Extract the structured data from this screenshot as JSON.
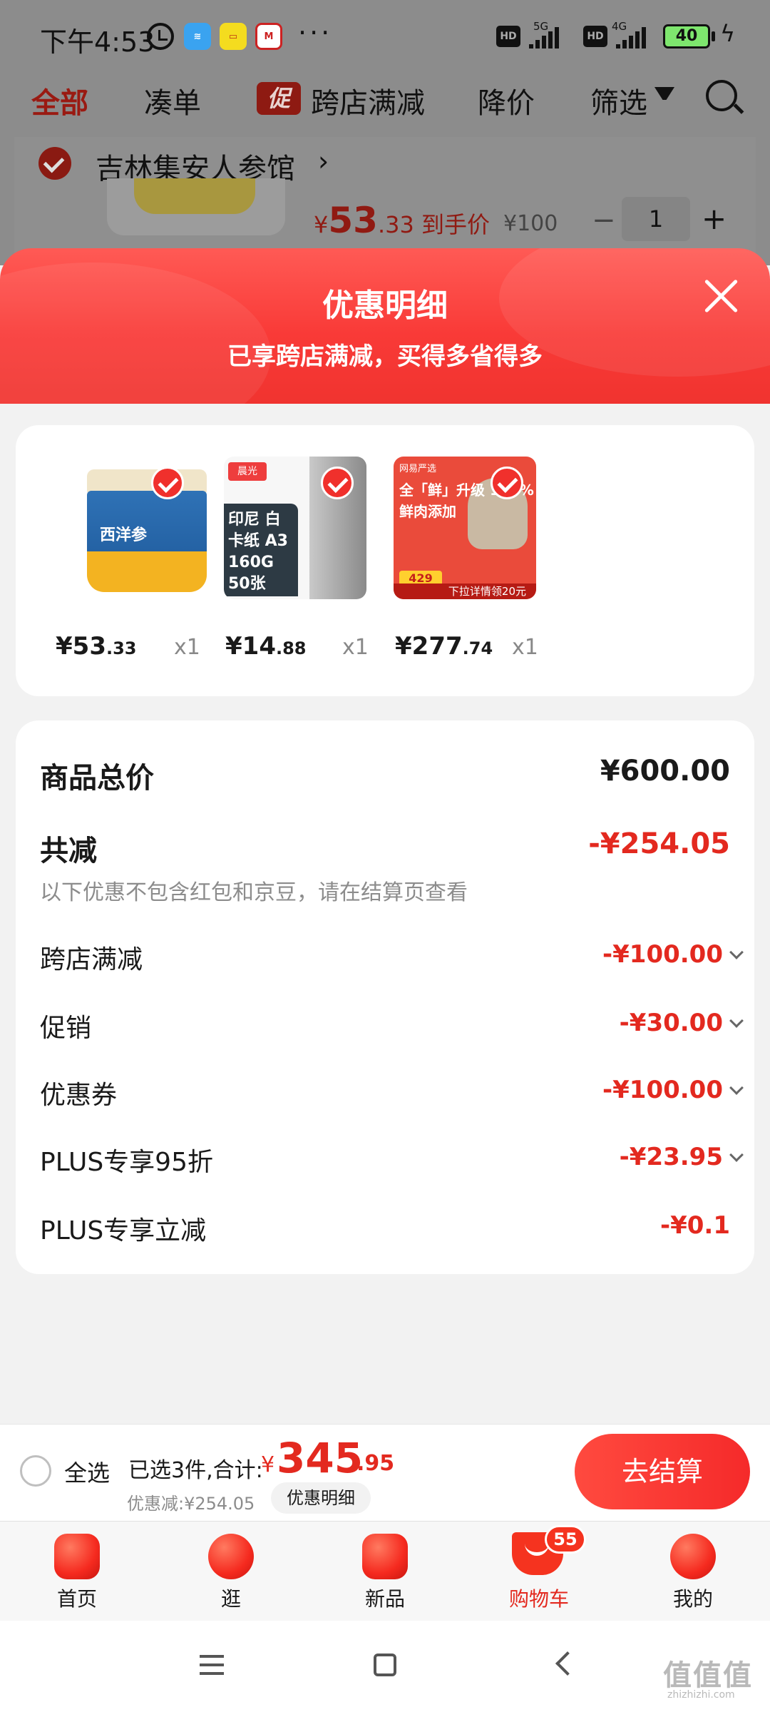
{
  "status_bar": {
    "time": "下午4:53",
    "app_icons": [
      "闲鱼",
      "淘宝",
      "招商"
    ],
    "more": "···",
    "network_1": "5G",
    "network_2": "4G",
    "hd": "HD",
    "battery": "40"
  },
  "top_tabs": {
    "all": "全部",
    "bundle": "凑单",
    "promo_tag": "促",
    "cross_store": "跨店满减",
    "price_drop": "降价",
    "filter": "筛选"
  },
  "store": {
    "name": "吉林集安人参馆",
    "arrow": "›",
    "price_yen": "¥",
    "price_int": "53",
    "price_dec": ".33",
    "price_suffix": " 到手价",
    "original_price": "¥100",
    "qty_minus": "−",
    "quantity": "1",
    "qty_plus": "+"
  },
  "sheet": {
    "title": "优惠明细",
    "subtitle": "已享跨店满减，买得多省得多"
  },
  "products": [
    {
      "price_int": "¥53",
      "price_dec": ".33",
      "qty": "x1",
      "img_text": "西洋参",
      "brand": ""
    },
    {
      "price_int": "¥14",
      "price_dec": ".88",
      "qty": "x1",
      "img_text": "印尼 白卡纸 A3 160G 50张",
      "brand": "晨光"
    },
    {
      "price_int": "¥277",
      "price_dec": ".74",
      "qty": "x1",
      "img_text": "全「鲜」升级 100% 鲜肉添加",
      "brand": "网易严选",
      "badge": "429",
      "band": "下拉详情领20元"
    }
  ],
  "breakdown": {
    "total_label": "商品总价",
    "total_value": "¥600.00",
    "reduce_label": "共减",
    "reduce_value": "-¥254.05",
    "note": "以下优惠不包含红包和京豆，请在结算页查看",
    "rows": [
      {
        "label": "跨店满减",
        "value": "-¥100.00",
        "expandable": true
      },
      {
        "label": "促销",
        "value": "-¥30.00",
        "expandable": true
      },
      {
        "label": "优惠券",
        "value": "-¥100.00",
        "expandable": true
      },
      {
        "label": "PLUS专享95折",
        "value": "-¥23.95",
        "expandable": true
      },
      {
        "label": "PLUS专享立减",
        "value": "-¥0.1",
        "expandable": false
      }
    ]
  },
  "checkout": {
    "select_all": "全选",
    "selected_text": "已选3件,合计:",
    "yen": "¥",
    "total_int": "345",
    "total_dec": ".95",
    "discount_text": "优惠减:¥254.05",
    "detail_pill": "优惠明细",
    "button": "去结算"
  },
  "bottom_nav": {
    "items": [
      {
        "label": "首页"
      },
      {
        "label": "逛"
      },
      {
        "label": "新品"
      },
      {
        "label": "购物车",
        "active": true,
        "badge": "55"
      },
      {
        "label": "我的"
      }
    ]
  },
  "watermark": {
    "text": "值值值",
    "sub": "zhizhizhi.com"
  },
  "colors": {
    "accent_red": "#e3291f",
    "header_red": "#f93a37",
    "dim_overlay": "#8c8c8c"
  }
}
